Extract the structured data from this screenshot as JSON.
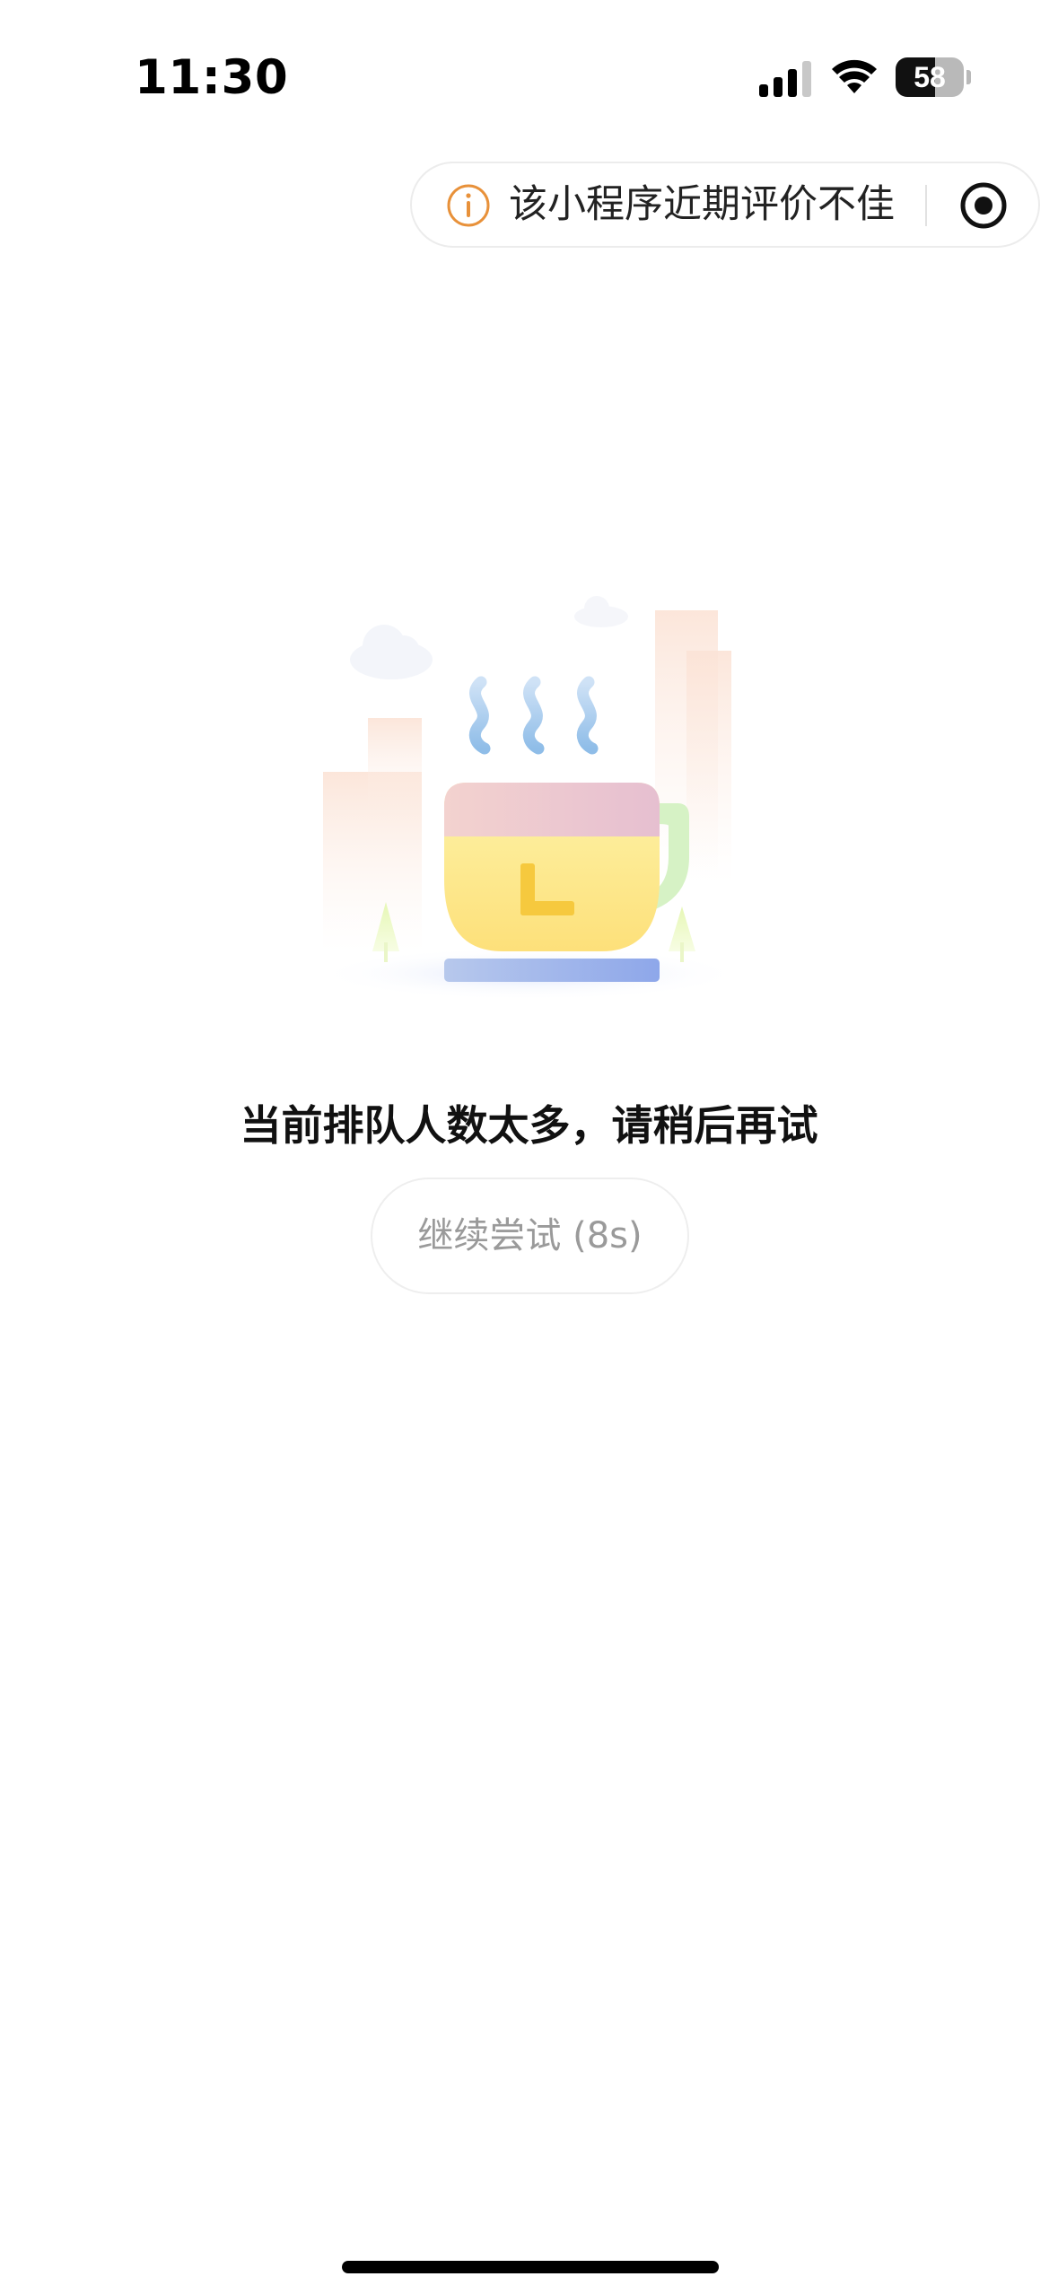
{
  "status_bar": {
    "time": "11:30",
    "battery_level": "58"
  },
  "capsule": {
    "notice_text": "该小程序近期评价不佳",
    "warning_icon": "info-warning-icon",
    "menu_icon": "target-circle-icon"
  },
  "main": {
    "message": "当前排队人数太多，请稍后再试",
    "retry_label": "继续尝试 (8s)"
  },
  "colors": {
    "warning_orange": "#e8913a",
    "retry_text": "#9a9a9a",
    "cup_yellow": "#fde68a",
    "cup_pink": "#e9c2cf",
    "steam_blue": "#9cc4ec"
  }
}
